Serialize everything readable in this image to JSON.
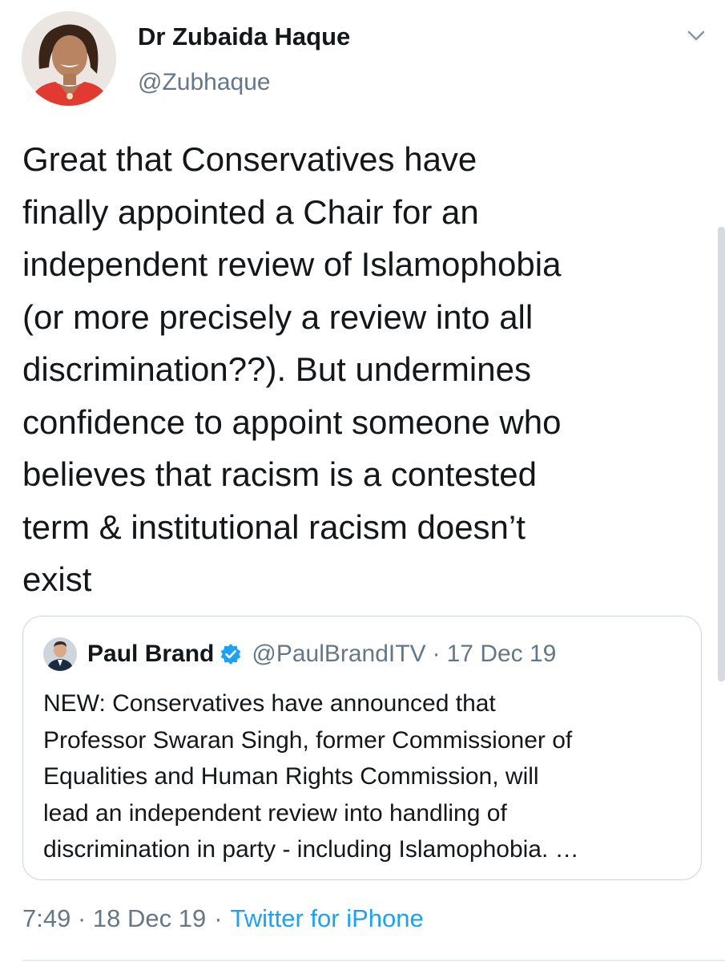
{
  "tweet": {
    "author": {
      "display_name": "Dr Zubaida Haque",
      "handle": "@Zubhaque"
    },
    "text": "Great that Conservatives have\nfinally appointed a Chair for an\nindependent review of Islamophobia\n(or more precisely a review into all\ndiscrimination??). But undermines\nconfidence to appoint someone who\nbelieves that racism is a contested\nterm & institutional racism doesn’t\nexist",
    "timestamp": "7:49 · 18 Dec 19",
    "separator": "·",
    "source": "Twitter for iPhone"
  },
  "quoted_tweet": {
    "display_name": "Paul Brand",
    "handle": "@PaulBrandITV",
    "separator": "·",
    "date": "17 Dec 19",
    "text": "NEW: Conservatives have announced that\nProfessor Swaran Singh, former Commissioner of\nEqualities and Human Rights Commission, will\nlead an independent review into handling of\ndiscrimination in party - including Islamophobia. …"
  },
  "icons": {
    "menu": "chevron-down-icon",
    "verified": "verified-badge-icon"
  },
  "colors": {
    "text": "#14171a",
    "secondary": "#657786",
    "link": "#1da1f2",
    "border": "#ccd6dd"
  }
}
